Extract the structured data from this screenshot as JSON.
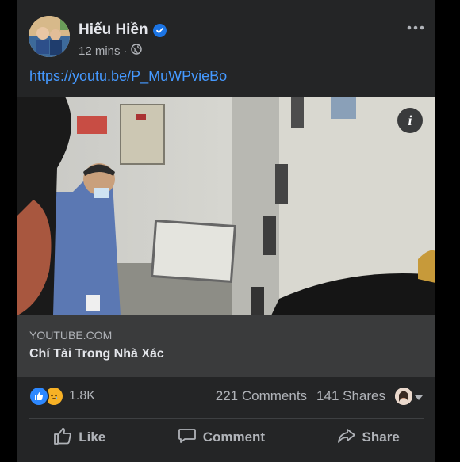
{
  "post": {
    "author": "Hiếu Hiền",
    "time": "12 mins",
    "separator": "·",
    "link_text": "https://youtu.be/P_MuWPvieBo"
  },
  "preview": {
    "domain": "YOUTUBE.COM",
    "title": "Chí Tài Trong Nhà Xác",
    "info_label": "i"
  },
  "engagement": {
    "reaction_count": "1.8K",
    "comments": "221 Comments",
    "shares": "141 Shares"
  },
  "actions": {
    "like": "Like",
    "comment": "Comment",
    "share": "Share"
  },
  "icons": [
    "verified-badge-icon",
    "globe-icon",
    "more-options-icon",
    "info-icon",
    "like-reaction-icon",
    "sad-reaction-icon",
    "dropdown-caret-icon",
    "like-icon",
    "comment-icon",
    "share-icon"
  ],
  "colors": {
    "card_bg": "#242526",
    "link": "#4599ff",
    "verified": "#1b74e4",
    "preview_bg": "#3a3b3c"
  }
}
